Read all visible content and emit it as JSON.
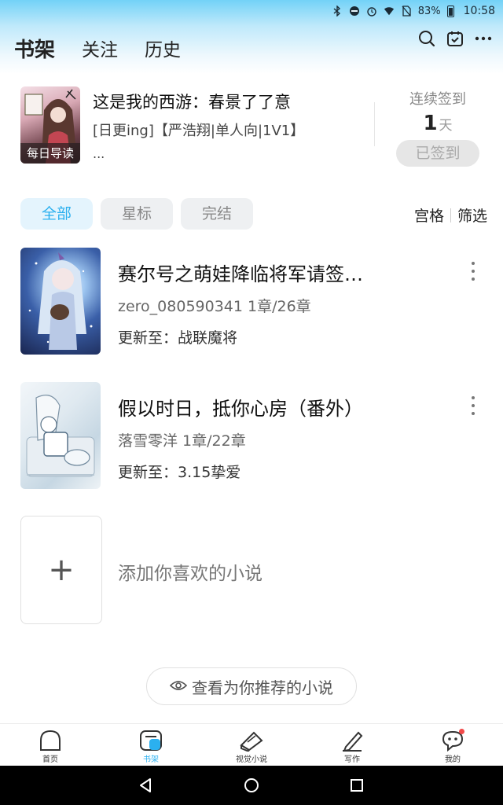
{
  "status_bar": {
    "battery": "83%",
    "time": "10:58",
    "icons": [
      "bluetooth-icon",
      "dnd-icon",
      "alarm-icon",
      "wifi-icon",
      "no-sim-icon",
      "battery-icon"
    ]
  },
  "header": {
    "tabs": [
      {
        "label": "书架",
        "active": true
      },
      {
        "label": "关注",
        "active": false
      },
      {
        "label": "历史",
        "active": false
      }
    ],
    "actions": [
      "search-icon",
      "calendar-check-icon",
      "more-icon"
    ]
  },
  "daily": {
    "cover_tag": "每日导读",
    "title": "这是我的西游：春景了了意",
    "desc": "[日更ing]【严浩翔|单人向|1V1】",
    "desc_more": "...",
    "sign_label": "连续签到",
    "streak_num": "1",
    "streak_unit": "天",
    "signed_label": "已签到"
  },
  "filters": {
    "chips": [
      "全部",
      "星标",
      "完结"
    ],
    "active_index": 0,
    "view_grid": "宫格",
    "view_filter": "筛选"
  },
  "books": [
    {
      "name": "赛尔号之萌娃降临将军请签…",
      "meta": "zero_080590341  1章/26章",
      "update": "更新至：战联魔将"
    },
    {
      "name": "假以时日，抵你心房（番外）",
      "meta": "落雪零洋  1章/22章",
      "update": "更新至：3.15挚爱"
    }
  ],
  "add_book": {
    "plus": "+",
    "label": "添加你喜欢的小说"
  },
  "recommend": {
    "label": "查看为你推荐的小说"
  },
  "bottom_nav": [
    {
      "label": "首页",
      "icon": "home-icon",
      "active": false
    },
    {
      "label": "书架",
      "icon": "bookshelf-icon",
      "active": true
    },
    {
      "label": "视觉小说",
      "icon": "visual-novel-icon",
      "active": false
    },
    {
      "label": "写作",
      "icon": "pen-icon",
      "active": false
    },
    {
      "label": "我的",
      "icon": "profile-chat-icon",
      "active": false
    }
  ],
  "colors": {
    "accent": "#2bb0ef",
    "header_top": "#73d2f7",
    "badge_red": "#f24a4a"
  }
}
